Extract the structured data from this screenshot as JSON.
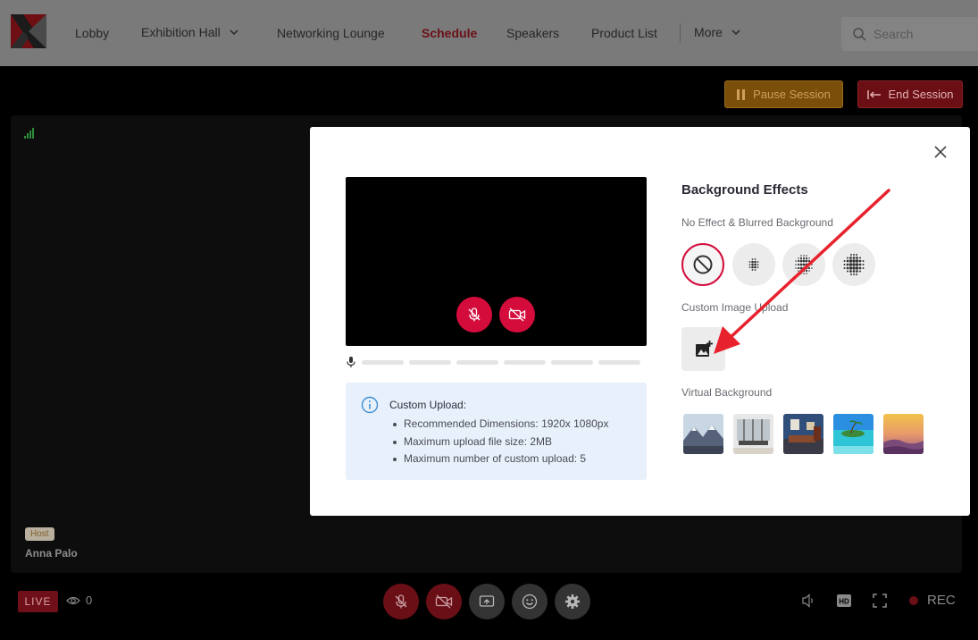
{
  "nav": {
    "items": [
      {
        "label": "Lobby",
        "dropdown": false,
        "active": false
      },
      {
        "label": "Exhibition Hall",
        "dropdown": true,
        "active": false
      },
      {
        "label": "Networking Lounge",
        "dropdown": false,
        "active": false
      },
      {
        "label": "Schedule",
        "dropdown": false,
        "active": true
      },
      {
        "label": "Speakers",
        "dropdown": false,
        "active": false
      },
      {
        "label": "Product List",
        "dropdown": false,
        "active": false
      },
      {
        "label": "More",
        "dropdown": true,
        "active": false
      }
    ],
    "search_placeholder": "Search"
  },
  "session": {
    "pause_label": "Pause Session",
    "end_label": "End Session"
  },
  "stage": {
    "host_badge": "Host",
    "host_name": "Anna Palo"
  },
  "controls": {
    "live_label": "LIVE",
    "viewer_count": "0",
    "rec_label": "REC",
    "buttons": [
      "mic-off",
      "camera-off",
      "screen-share",
      "emoji",
      "settings"
    ]
  },
  "modal": {
    "title": "Background Effects",
    "no_effect_label": "No Effect & Blurred Background",
    "custom_upload_label": "Custom Image Upload",
    "virtual_bg_label": "Virtual Background",
    "effects": [
      "no-effect",
      "blur-low",
      "blur-medium",
      "blur-high"
    ],
    "virtual_backgrounds": [
      "mountains",
      "office-interior",
      "living-room",
      "tropical-beach",
      "sunset-sky"
    ],
    "info": {
      "title": "Custom Upload:",
      "items": [
        "Recommended Dimensions: 1920x 1080px",
        "Maximum upload file size: 2MB",
        "Maximum number of custom upload: 5"
      ]
    }
  },
  "colors": {
    "accent": "#d40c3c",
    "nav_active": "#6a1016",
    "info_bg": "#e8f1fb"
  }
}
